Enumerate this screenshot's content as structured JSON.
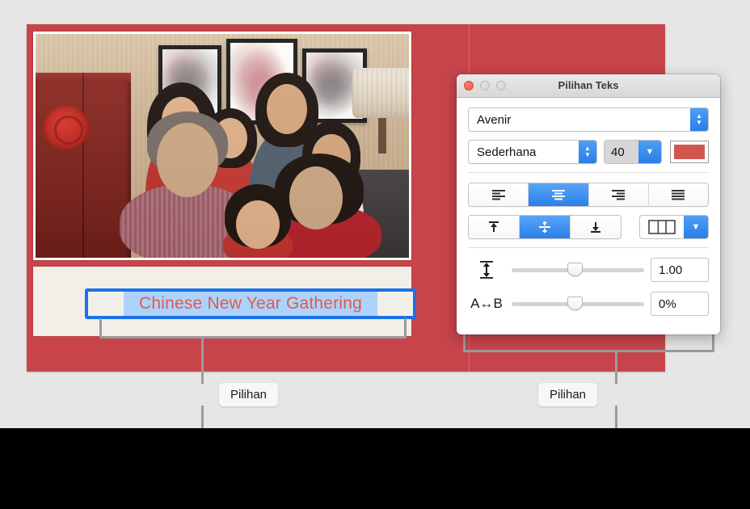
{
  "slide": {
    "caption_text": "Chinese New Year Gathering",
    "caption_color": "#e05a4e",
    "selection_color": "#aed3fb",
    "textbox_border_color": "#1a72e8",
    "background_color": "#c8444b"
  },
  "callouts": {
    "left_label": "Pilihan",
    "right_label": "Pilihan"
  },
  "panel": {
    "title": "Pilihan Teks",
    "font": {
      "family_value": "Avenir",
      "style_value": "Sederhana",
      "size_value": "40",
      "color_swatch": "#d2564f"
    },
    "alignment": {
      "buttons": [
        {
          "name": "align-left",
          "icon": "align-left-icon",
          "selected": false
        },
        {
          "name": "align-center",
          "icon": "align-center-icon",
          "selected": true
        },
        {
          "name": "align-right",
          "icon": "align-right-icon",
          "selected": false
        },
        {
          "name": "align-justify",
          "icon": "align-justify-icon",
          "selected": false
        }
      ]
    },
    "vertical_alignment": {
      "buttons": [
        {
          "name": "align-top",
          "icon": "align-top-icon",
          "selected": false
        },
        {
          "name": "align-middle",
          "icon": "align-middle-icon",
          "selected": true
        },
        {
          "name": "align-bottom",
          "icon": "align-bottom-icon",
          "selected": false
        }
      ]
    },
    "columns": {
      "icon": "columns-icon",
      "chevron": "chevron-down-icon"
    },
    "spacing": {
      "line_icon": "line-spacing-icon",
      "line_value": "1.00",
      "line_knob_percent": 47,
      "char_icon": "A↔B",
      "char_value": "0%",
      "char_knob_percent": 47
    },
    "window_buttons": {
      "close": "close-button",
      "minimize": "minimize-button",
      "zoom": "zoom-button"
    },
    "accent_color": "#2a7ee8"
  }
}
